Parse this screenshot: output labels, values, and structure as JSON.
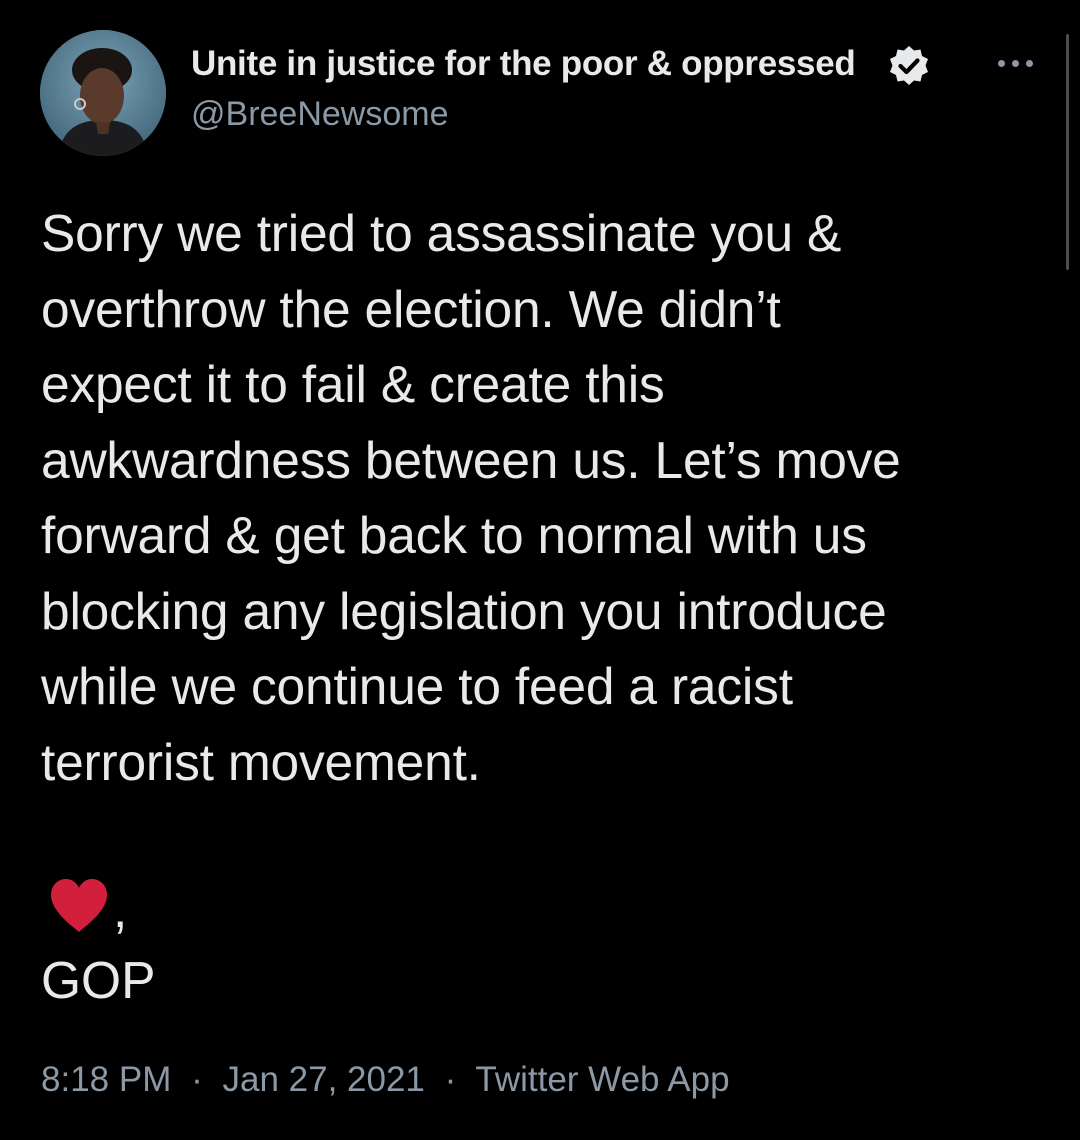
{
  "author": {
    "display_name": "Unite in justice for the poor & oppressed",
    "handle": "@BreeNewsome",
    "verified": true
  },
  "tweet": {
    "lines": [
      "Sorry we tried to assassinate you &",
      "overthrow the election. We didn’t",
      "expect it to fail & create this",
      "awkwardness between us. Let’s move",
      "forward & get back to normal with us",
      "blocking any legislation you introduce",
      "while we continue to feed a racist",
      "terrorist movement."
    ],
    "closing_punct": ",",
    "signature": "GOP"
  },
  "meta": {
    "time": "8:18 PM",
    "separator": "·",
    "date": "Jan 27, 2021",
    "source": "Twitter Web App"
  },
  "icons": {
    "verified": "verified-badge-icon",
    "more": "more-horizontal-icon",
    "heart": "red-heart-emoji"
  },
  "colors": {
    "background": "#000000",
    "text_primary": "#e7e9ea",
    "text_secondary": "#8b98a5",
    "heart": "#d21f3c"
  }
}
